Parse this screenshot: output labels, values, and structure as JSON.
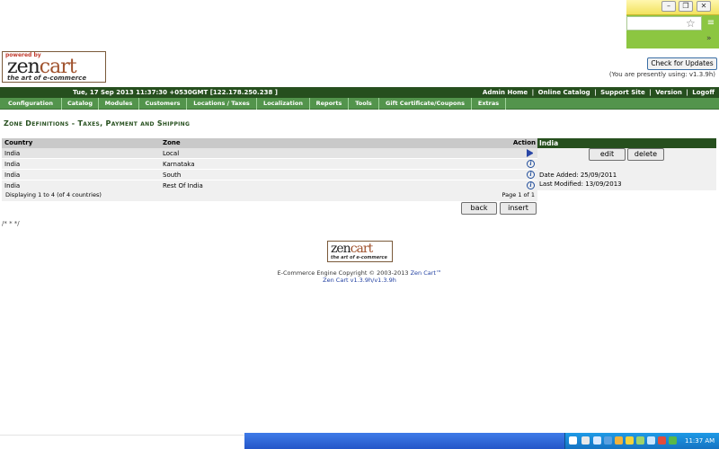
{
  "browser": {
    "min_glyph": "–",
    "restore_glyph": "❐",
    "close_glyph": "✕",
    "star_glyph": "☆",
    "menu_glyph": "≡",
    "chevrons": "»"
  },
  "logo": {
    "powered": "powered by",
    "zen": "zen",
    "cart": "cart",
    "tagline": "the art of e-commerce"
  },
  "updates": {
    "button_label": "Check for Updates",
    "version_note": "(You are presently using: v1.3.9h)"
  },
  "header": {
    "datetime": "Tue, 17 Sep 2013 11:37:30 +0530GMT [122.178.250.238 ]",
    "links": [
      "Admin Home",
      "Online Catalog",
      "Support Site",
      "Version",
      "Logoff"
    ],
    "separator": "|"
  },
  "nav": [
    "Configuration",
    "Catalog",
    "Modules",
    "Customers",
    "Locations / Taxes",
    "Localization",
    "Reports",
    "Tools",
    "Gift Certificate/Coupons",
    "Extras"
  ],
  "page": {
    "title": "Zone Definitions - Taxes, Payment and Shipping"
  },
  "table": {
    "headers": {
      "country": "Country",
      "zone": "Zone",
      "action": "Action"
    },
    "rows": [
      {
        "country": "India",
        "zone": "Local",
        "action": "arrow-icon"
      },
      {
        "country": "India",
        "zone": "Karnataka",
        "action": "info-icon"
      },
      {
        "country": "India",
        "zone": "South",
        "action": "info-icon"
      },
      {
        "country": "India",
        "zone": "Rest Of India",
        "action": "info-icon"
      }
    ],
    "info_glyph": "i",
    "displaying": "Displaying 1 to 4 (of 4 countries)",
    "page_info": "Page 1 of 1"
  },
  "buttons": {
    "back": "back",
    "insert": "insert",
    "edit": "edit",
    "delete": "delete"
  },
  "side": {
    "title": "India",
    "date_added": "Date Added: 25/09/2011",
    "last_modified": "Last Modified: 13/09/2013"
  },
  "stray_text": "/* * */",
  "footer": {
    "copyright_text": "E-Commerce Engine Copyright © 2003-2013",
    "copyright_link": "Zen Cart™",
    "version": "Zen Cart v1.3.9h/v1.3.9h"
  },
  "taskbar": {
    "clock": "11:37 AM"
  },
  "colors": {
    "header_dark_green": "#264f1e",
    "nav_green": "#53944c",
    "chrome_green": "#8cc641",
    "taskbar_blue": "#2456c8"
  }
}
